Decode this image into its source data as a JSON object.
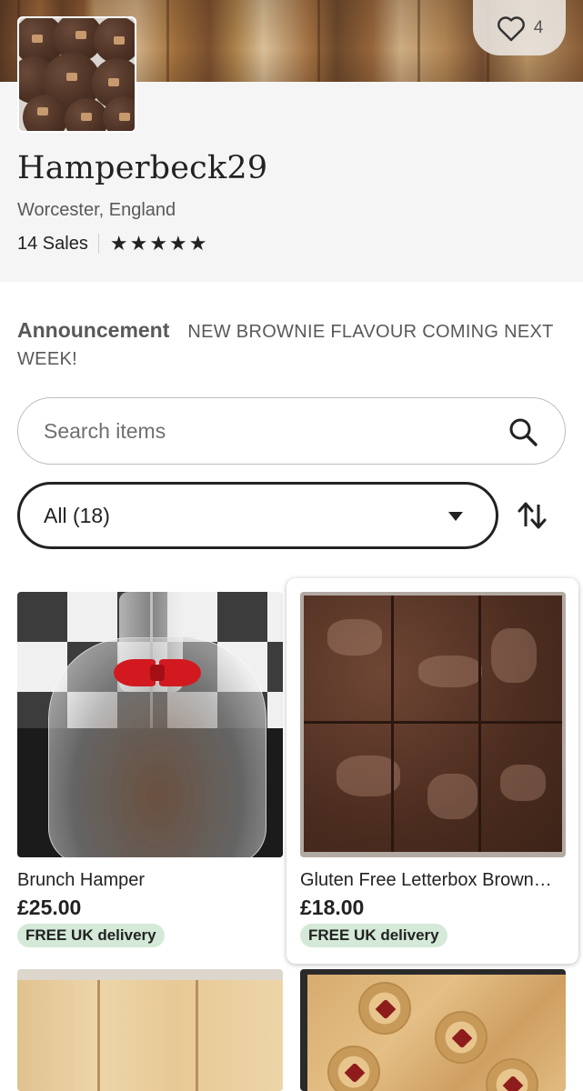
{
  "shop": {
    "name": "Hamperbeck29",
    "location": "Worcester, England",
    "sales": "14 Sales",
    "rating_stars": 5,
    "favorites_count": "4"
  },
  "announcement": {
    "heading": "Announcement",
    "text": "NEW BROWNIE FLAVOUR COMING NEXT WEEK!"
  },
  "search": {
    "placeholder": "Search items",
    "icon": "search-icon"
  },
  "filter": {
    "selected": "All (18)",
    "sort_icon": "sort-arrows-icon"
  },
  "listings": [
    {
      "title": "Brunch Hamper",
      "price": "£25.00",
      "badge": "FREE UK delivery"
    },
    {
      "title": "Gluten Free Letterbox Brown…",
      "price": "£18.00",
      "badge": "FREE UK delivery"
    }
  ],
  "colors": {
    "badge_bg": "#d4e9d7",
    "text_primary": "#222222",
    "text_secondary": "#595959",
    "header_bg": "#f5f5f5"
  }
}
